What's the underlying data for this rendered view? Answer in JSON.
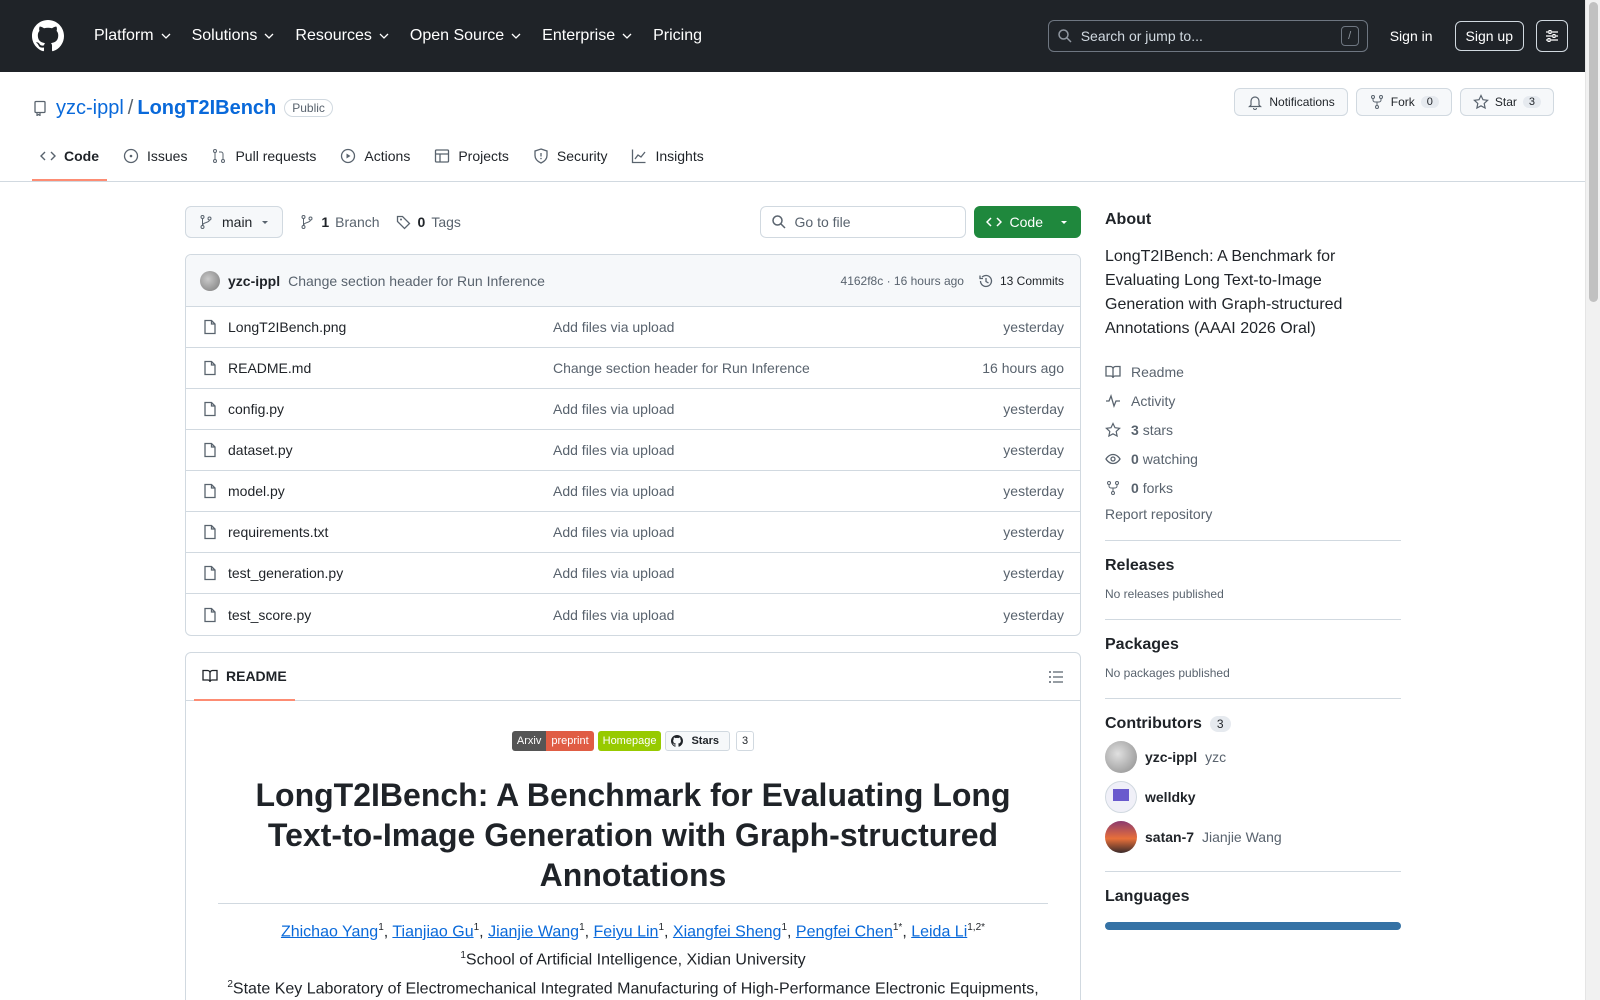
{
  "header": {
    "nav": [
      "Platform",
      "Solutions",
      "Resources",
      "Open Source",
      "Enterprise",
      "Pricing"
    ],
    "search_placeholder": "Search or jump to...",
    "search_shortcut": "/",
    "sign_in": "Sign in",
    "sign_up": "Sign up"
  },
  "repo": {
    "owner": "yzc-ippl",
    "separator": "/",
    "name": "LongT2IBench",
    "visibility": "Public",
    "notifications_label": "Notifications",
    "fork_label": "Fork",
    "fork_count": "0",
    "star_label": "Star",
    "star_count": "3"
  },
  "tabs": [
    {
      "label": "Code",
      "icon": "code-icon",
      "active": true
    },
    {
      "label": "Issues",
      "icon": "issue-icon"
    },
    {
      "label": "Pull requests",
      "icon": "pull-request-icon"
    },
    {
      "label": "Actions",
      "icon": "play-icon"
    },
    {
      "label": "Projects",
      "icon": "table-icon"
    },
    {
      "label": "Security",
      "icon": "shield-icon"
    },
    {
      "label": "Insights",
      "icon": "graph-icon"
    }
  ],
  "toolbar": {
    "branch": "main",
    "branch_count": "1",
    "branch_label": "Branch",
    "tag_count": "0",
    "tag_label": "Tags",
    "goto_placeholder": "Go to file",
    "code_label": "Code"
  },
  "commit": {
    "author": "yzc-ippl",
    "message": "Change section header for Run Inference",
    "hash": "4162f8c",
    "dot": "·",
    "time": "16 hours ago",
    "commits_label": "13 Commits"
  },
  "files": [
    {
      "name": "LongT2IBench.png",
      "message": "Add files via upload",
      "time": "yesterday"
    },
    {
      "name": "README.md",
      "message": "Change section header for Run Inference",
      "time": "16 hours ago"
    },
    {
      "name": "config.py",
      "message": "Add files via upload",
      "time": "yesterday"
    },
    {
      "name": "dataset.py",
      "message": "Add files via upload",
      "time": "yesterday"
    },
    {
      "name": "model.py",
      "message": "Add files via upload",
      "time": "yesterday"
    },
    {
      "name": "requirements.txt",
      "message": "Add files via upload",
      "time": "yesterday"
    },
    {
      "name": "test_generation.py",
      "message": "Add files via upload",
      "time": "yesterday"
    },
    {
      "name": "test_score.py",
      "message": "Add files via upload",
      "time": "yesterday"
    }
  ],
  "readme": {
    "tab_label": "README",
    "badges": {
      "arxiv_left": "Arxiv",
      "arxiv_right": "preprint",
      "homepage": "Homepage",
      "stars_label": "Stars",
      "stars_count": "3"
    },
    "title": "LongT2IBench: A Benchmark for Evaluating Long Text-to-Image Generation with Graph-structured Annotations",
    "authors": [
      {
        "name": "Zhichao Yang",
        "sup": "1"
      },
      {
        "name": "Tianjiao Gu",
        "sup": "1"
      },
      {
        "name": "Jianjie Wang",
        "sup": "1"
      },
      {
        "name": "Feiyu Lin",
        "sup": "1"
      },
      {
        "name": "Xiangfei Sheng",
        "sup": "1"
      },
      {
        "name": "Pengfei Chen",
        "sup": "1*"
      },
      {
        "name": "Leida Li",
        "sup": "1,2*"
      }
    ],
    "affil1_sup": "1",
    "affil1": "School of Artificial Intelligence, Xidian University",
    "affil2_sup": "2",
    "affil2": "State Key Laboratory of Electromechanical Integrated Manufacturing of High-Performance Electronic Equipments,"
  },
  "sidebar": {
    "about_title": "About",
    "description": "LongT2IBench: A Benchmark for Evaluating Long Text-to-Image Generation with Graph-structured Annotations (AAAI 2026 Oral)",
    "readme": "Readme",
    "activity": "Activity",
    "stars_count": "3",
    "stars_label": "stars",
    "watching_count": "0",
    "watching_label": "watching",
    "forks_count": "0",
    "forks_label": "forks",
    "report": "Report repository",
    "releases_title": "Releases",
    "releases_sub": "No releases published",
    "packages_title": "Packages",
    "packages_sub": "No packages published",
    "contributors_title": "Contributors",
    "contributors_count": "3",
    "contributors": [
      {
        "login": "yzc-ippl",
        "name": "yzc"
      },
      {
        "login": "welldky",
        "name": ""
      },
      {
        "login": "satan-7",
        "name": "Jianjie Wang"
      }
    ],
    "languages_title": "Languages",
    "language_color": "#3572a5"
  }
}
